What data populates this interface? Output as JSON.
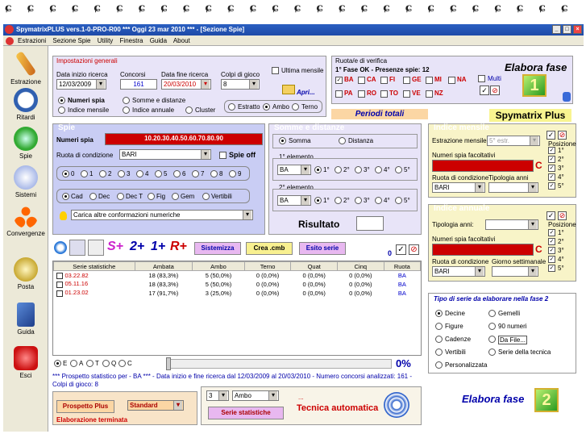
{
  "window": {
    "title": "SpymatrixPLUS vers.1-0-PRO-R00   ***  Oggi 23 mar 2010  ***  - [Sezione Spie]"
  },
  "menu": [
    "Estrazioni",
    "Sezione Spie",
    "Utility",
    "Finestra",
    "Guida",
    "About"
  ],
  "sidebar": [
    "Estrazione",
    "Ritardi",
    "Spie",
    "Sistemi",
    "Convergenze",
    "Posta",
    "Guida",
    "Esci"
  ],
  "impostazioni": {
    "title": "Impostazioni generali",
    "data_inizio_label": "Data inizio ricerca",
    "data_inizio": "12/03/2009",
    "concorsi_label": "Concorsi",
    "concorsi": "161",
    "data_fine_label": "Data fine ricerca",
    "data_fine": "20/03/2010",
    "colpi_label": "Colpi di gioco",
    "colpi": "8",
    "ultima_mensile": "Ultima mensile",
    "apri": "Apri...",
    "numeri_spia": "Numeri spia",
    "somme_distanze": "Somme e distanze",
    "indice_mensile": "Indice mensile",
    "indice_annuale": "Indice annuale",
    "cluster": "Cluster",
    "estratto": "Estratto",
    "ambo": "Ambo",
    "terno": "Terno"
  },
  "ruota_verifica": {
    "title": "Ruota/e di verifica",
    "status": "1° Fase OK - Presenze spie: 12",
    "ruote_row1": [
      "BA",
      "CA",
      "FI",
      "GE",
      "MI",
      "NA"
    ],
    "ruote_row2": [
      "PA",
      "RO",
      "TO",
      "VE",
      "NZ"
    ],
    "multi": "Multi",
    "elabora": "Elabora fase",
    "fase_num": "1"
  },
  "periodi_totali": "Periodi totali",
  "brand": "Spymatrix Plus",
  "spie": {
    "title": "Spie",
    "numeri_label": "Numeri spia",
    "numeri": "10.20.30.40.50.60.70.80.90",
    "ruota_label": "Ruota di condizione",
    "ruota": "BARI",
    "spie_off": "Spie off",
    "digits": [
      "0",
      "1",
      "2",
      "3",
      "4",
      "5",
      "6",
      "7",
      "8",
      "9"
    ],
    "cad_options": [
      "Cad",
      "Dec",
      "Dec T",
      "Fig",
      "Gem",
      "Vertibili"
    ],
    "carica": "Carica altre conformazioni numeriche"
  },
  "somme": {
    "title": "Somme e distanze",
    "somma": "Somma",
    "distanza": "Distanza",
    "el1": "1° elemento",
    "el2": "2° elemento",
    "ruota1": "BA",
    "ruota2": "BA",
    "pos": [
      "1°",
      "2°",
      "3°",
      "4°",
      "5°"
    ],
    "risultato": "Risultato"
  },
  "indice_mensile": {
    "title": "Indice mensile",
    "estrazione_label": "Estrazione mensile:",
    "estrazione": "5° estr.",
    "numeri_label": "Numeri spia facoltativi",
    "c": "C",
    "ruota_label": "Ruota di condizione",
    "ruota": "BARI",
    "tipologia_label": "Tipologia anni",
    "posizione": "Posizione",
    "pos": [
      "1°",
      "2°",
      "3°",
      "4°",
      "5°"
    ]
  },
  "indice_annuale": {
    "title": "Indice annuale",
    "tipologia_label": "Tipologia anni:",
    "numeri_label": "Numeri spia facoltativi",
    "c": "C",
    "ruota_label": "Ruota di condizione",
    "ruota": "BARI",
    "giorno_label": "Giorno settimanale",
    "posizione": "Posizione",
    "pos": [
      "1°",
      "2°",
      "3°",
      "4°",
      "5°"
    ]
  },
  "toolbar": {
    "splus": "S+",
    "two_plus": "2+",
    "one_plus": "1+",
    "rplus": "R+",
    "sistemizza": "Sistemizza",
    "crea": "Crea .cmb",
    "esito": "Esito serie",
    "zero": "0"
  },
  "table": {
    "headers": [
      "Serie statistiche",
      "Ambata",
      "Ambo",
      "Terno",
      "Quat",
      "Cinq",
      "Ruota"
    ],
    "rows": [
      [
        "03.22.82",
        "18 (83,3%)",
        "5 (50,0%)",
        "0 (0,0%)",
        "0 (0,0%)",
        "0 (0,0%)",
        "BA"
      ],
      [
        "05.11.16",
        "18 (83,3%)",
        "5 (50,0%)",
        "0 (0,0%)",
        "0 (0,0%)",
        "0 (0,0%)",
        "BA"
      ],
      [
        "01.23.02",
        "17 (91,7%)",
        "3 (25,0%)",
        "0 (0,0%)",
        "0 (0,0%)",
        "0 (0,0%)",
        "BA"
      ]
    ]
  },
  "bottom_radios": [
    "E",
    "A",
    "T",
    "Q",
    "C"
  ],
  "progress_pct": "0%",
  "prospetto_text": "*** Prospetto statistico per  - BA *** - Data inizio e fine ricerca dal 12/03/2009 al 20/03/2010 - Numero concorsi analizzati: 161 - Colpi di gioco: 8",
  "bottom": {
    "prospetto_btn": "Prospetto Plus",
    "standard": "Standard",
    "terminata": "Elaborazione terminata",
    "num": "3",
    "ambo": "Ambo",
    "serie_btn": "Serie statistiche",
    "dots": "...",
    "tecnica": "Tecnica automatica"
  },
  "fase2": {
    "title": "Tipo di serie da elaborare nella fase 2",
    "options_left": [
      "Decine",
      "Figure",
      "Cadenze",
      "Vertibili",
      "Personalizzata"
    ],
    "options_right": [
      "Gemelli",
      "90 numeri",
      "Da File...",
      "Serie della tecnica"
    ],
    "elabora": "Elabora fase",
    "fase_num": "2"
  }
}
